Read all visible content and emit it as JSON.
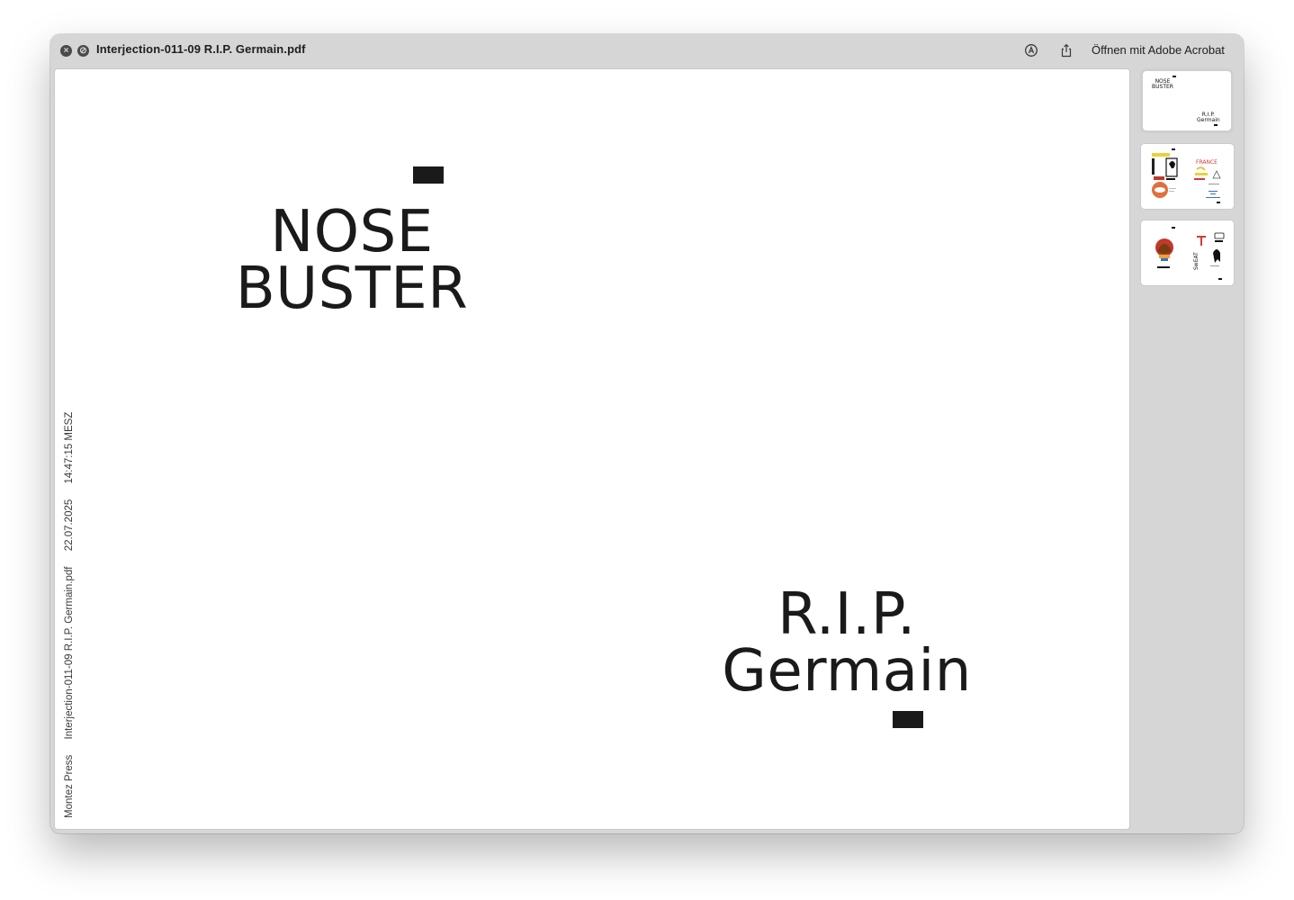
{
  "window": {
    "title": "Interjection-011-09 R.I.P. Germain.pdf",
    "open_button_label": "Öffnen mit Adobe Acrobat",
    "close_glyph": "×",
    "minimize_glyph": "⊘"
  },
  "icons": {
    "markup": "markup-icon",
    "share": "share-icon"
  },
  "page": {
    "left_text_line1": "NOSE",
    "left_text_line2": "BUSTER",
    "right_text_line1": "R.I.P.",
    "right_text_line2": "Germain",
    "side_info": {
      "publisher": "Montez Press",
      "filename": "Interjection-011-09 R.I.P. Germain.pdf",
      "date": "22.07.2025",
      "time": "14:47:15 MESZ"
    }
  },
  "thumbnails": {
    "first": {
      "line1": "NOSE",
      "line2": "BUSTER",
      "line3": "R.I.P.",
      "line4": "Germain"
    },
    "count": 3
  }
}
